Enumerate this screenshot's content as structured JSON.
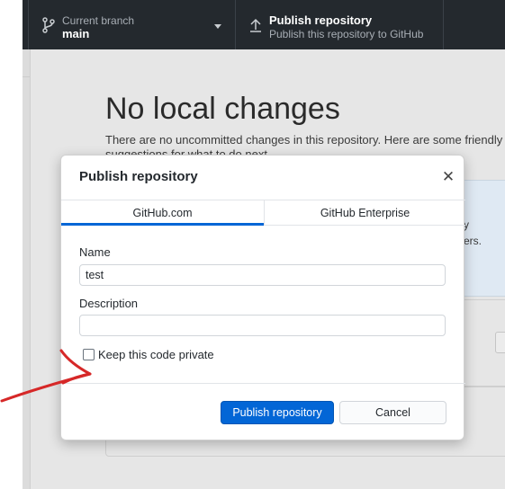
{
  "toolbar": {
    "branch": {
      "title": "Current branch",
      "value": "main"
    },
    "publish": {
      "title": "Publish repository",
      "subtitle": "Publish this repository to GitHub"
    }
  },
  "main": {
    "heading": "No local changes",
    "text_line1": "There are no uncommitted changes in this repository. Here are some friendly",
    "text_line2": "suggestions for what to do next",
    "card_fragment1": "y",
    "card_fragment2": "ers."
  },
  "dialog": {
    "title": "Publish repository",
    "close_icon": "close-icon",
    "tabs": [
      {
        "label": "GitHub.com",
        "active": true
      },
      {
        "label": "GitHub Enterprise",
        "active": false
      }
    ],
    "name_label": "Name",
    "name_value": "test",
    "description_label": "Description",
    "description_value": "",
    "private_label": "Keep this code private",
    "private_checked": false,
    "publish_button": "Publish repository",
    "cancel_button": "Cancel"
  },
  "colors": {
    "toolbar_bg": "#24292e",
    "accent": "#0366d6",
    "annotation_arrow": "#d62828"
  }
}
